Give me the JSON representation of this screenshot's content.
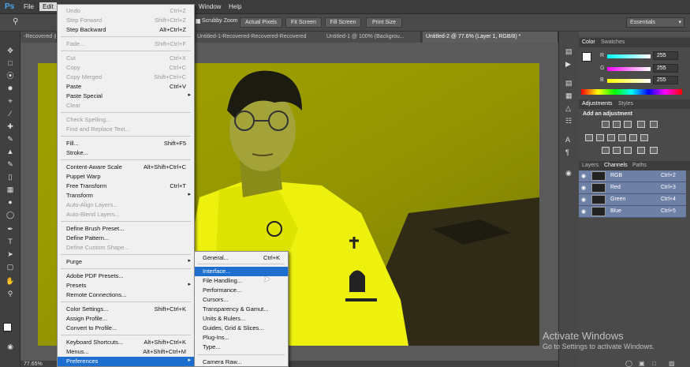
{
  "menubar": {
    "logo": "Ps",
    "items": [
      "File",
      "Edit",
      "Window",
      "Help"
    ]
  },
  "options": {
    "scrubby_zoom": "Scrubby Zoom",
    "buttons": [
      "Actual Pixels",
      "Fit Screen",
      "Fill Screen",
      "Print Size"
    ],
    "workspace": "Essentials"
  },
  "tabs": [
    "-Recovered @",
    "Untitled-1-Recovered-Recovered-Recovered",
    "Untitled-1 @ 100% (Backgrou...",
    "Untitled-2 @ 77.6% (Layer 1, RGB/8) *"
  ],
  "edit_menu": {
    "items": [
      {
        "label": "Undo",
        "shortcut": "Ctrl+Z",
        "disabled": true
      },
      {
        "label": "Step Forward",
        "shortcut": "Shift+Ctrl+Z",
        "disabled": true
      },
      {
        "label": "Step Backward",
        "shortcut": "Alt+Ctrl+Z",
        "disabled": false
      },
      {
        "label": "Fade...",
        "shortcut": "Shift+Ctrl+F",
        "disabled": true
      },
      {
        "label": "Cut",
        "shortcut": "Ctrl+X",
        "disabled": true
      },
      {
        "label": "Copy",
        "shortcut": "Ctrl+C",
        "disabled": true
      },
      {
        "label": "Copy Merged",
        "shortcut": "Shift+Ctrl+C",
        "disabled": true
      },
      {
        "label": "Paste",
        "shortcut": "Ctrl+V",
        "disabled": false
      },
      {
        "label": "Paste Special",
        "shortcut": "",
        "disabled": false
      },
      {
        "label": "Clear",
        "shortcut": "",
        "disabled": true
      },
      {
        "label": "Check Spelling...",
        "shortcut": "",
        "disabled": true
      },
      {
        "label": "Find and Replace Text...",
        "shortcut": "",
        "disabled": true
      },
      {
        "label": "Fill...",
        "shortcut": "Shift+F5",
        "disabled": false
      },
      {
        "label": "Stroke...",
        "shortcut": "",
        "disabled": false
      },
      {
        "label": "Content-Aware Scale",
        "shortcut": "Alt+Shift+Ctrl+C",
        "disabled": false
      },
      {
        "label": "Puppet Warp",
        "shortcut": "",
        "disabled": false
      },
      {
        "label": "Free Transform",
        "shortcut": "Ctrl+T",
        "disabled": false
      },
      {
        "label": "Transform",
        "shortcut": "",
        "disabled": false
      },
      {
        "label": "Auto-Align Layers...",
        "shortcut": "",
        "disabled": true
      },
      {
        "label": "Auto-Blend Layers...",
        "shortcut": "",
        "disabled": true
      },
      {
        "label": "Define Brush Preset...",
        "shortcut": "",
        "disabled": false
      },
      {
        "label": "Define Pattern...",
        "shortcut": "",
        "disabled": false
      },
      {
        "label": "Define Custom Shape...",
        "shortcut": "",
        "disabled": true
      },
      {
        "label": "Purge",
        "shortcut": "",
        "disabled": false
      },
      {
        "label": "Adobe PDF Presets...",
        "shortcut": "",
        "disabled": false
      },
      {
        "label": "Presets",
        "shortcut": "",
        "disabled": false
      },
      {
        "label": "Remote Connections...",
        "shortcut": "",
        "disabled": false
      },
      {
        "label": "Color Settings...",
        "shortcut": "Shift+Ctrl+K",
        "disabled": false
      },
      {
        "label": "Assign Profile...",
        "shortcut": "",
        "disabled": false
      },
      {
        "label": "Convert to Profile...",
        "shortcut": "",
        "disabled": false
      },
      {
        "label": "Keyboard Shortcuts...",
        "shortcut": "Alt+Shift+Ctrl+K",
        "disabled": false
      },
      {
        "label": "Menus...",
        "shortcut": "Alt+Shift+Ctrl+M",
        "disabled": false
      },
      {
        "label": "Preferences",
        "shortcut": "",
        "disabled": false
      }
    ]
  },
  "preferences_menu": {
    "items": [
      {
        "label": "General...",
        "shortcut": "Ctrl+K"
      },
      {
        "label": "Interface...",
        "shortcut": ""
      },
      {
        "label": "File Handling...",
        "shortcut": ""
      },
      {
        "label": "Performance...",
        "shortcut": ""
      },
      {
        "label": "Cursors...",
        "shortcut": ""
      },
      {
        "label": "Transparency & Gamut...",
        "shortcut": ""
      },
      {
        "label": "Units & Rulers...",
        "shortcut": ""
      },
      {
        "label": "Guides, Grid & Slices...",
        "shortcut": ""
      },
      {
        "label": "Plug-Ins...",
        "shortcut": ""
      },
      {
        "label": "Type...",
        "shortcut": ""
      },
      {
        "label": "Camera Raw...",
        "shortcut": ""
      }
    ]
  },
  "color_panel": {
    "tabs": [
      "Color",
      "Swatches"
    ],
    "channels": [
      {
        "label": "R",
        "value": "255"
      },
      {
        "label": "G",
        "value": "255"
      },
      {
        "label": "B",
        "value": "255"
      }
    ]
  },
  "adjustments_panel": {
    "tabs": [
      "Adjustments",
      "Styles"
    ],
    "heading": "Add an adjustment"
  },
  "channels_panel": {
    "tabs": [
      "Layers",
      "Channels",
      "Paths"
    ],
    "rows": [
      {
        "name": "RGB",
        "shortcut": "Ctrl+2"
      },
      {
        "name": "Red",
        "shortcut": "Ctrl+3"
      },
      {
        "name": "Green",
        "shortcut": "Ctrl+4"
      },
      {
        "name": "Blue",
        "shortcut": "Ctrl+5"
      }
    ]
  },
  "status": {
    "zoom": "77.65%"
  },
  "watermark": {
    "line1": "Activate Windows",
    "line2": "Go to Settings to activate Windows."
  },
  "colors": {
    "highlight": "#1c6fcf",
    "photo": "#a2a500"
  }
}
